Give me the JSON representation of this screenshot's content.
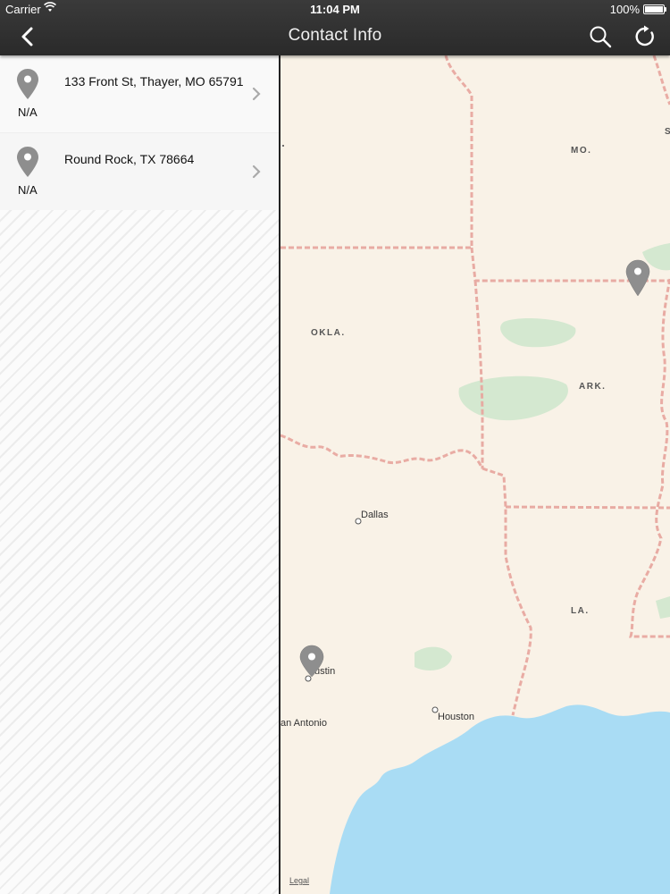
{
  "status_bar": {
    "carrier": "Carrier",
    "time": "11:04 PM",
    "battery": "100%"
  },
  "nav": {
    "title": "Contact Info",
    "icons": [
      "back-chevron-icon",
      "search-icon",
      "refresh-icon"
    ]
  },
  "locations": [
    {
      "address": "133 Front St, Thayer, MO 65791",
      "distance": "N/A"
    },
    {
      "address": "Round Rock, TX 78664",
      "distance": "N/A"
    }
  ],
  "map": {
    "states": [
      "MO.",
      "OKLA.",
      "ARK.",
      "LA.",
      "S"
    ],
    "cities": [
      "Dallas",
      "ustin",
      "an Antonio",
      "Houston"
    ],
    "legal": "Legal",
    "colors": {
      "land": "#f9f2e7",
      "water": "#a9dcf4",
      "border": "#e8a8a0",
      "park": "#d4e8d0",
      "pin": "#8e8e8e"
    }
  }
}
